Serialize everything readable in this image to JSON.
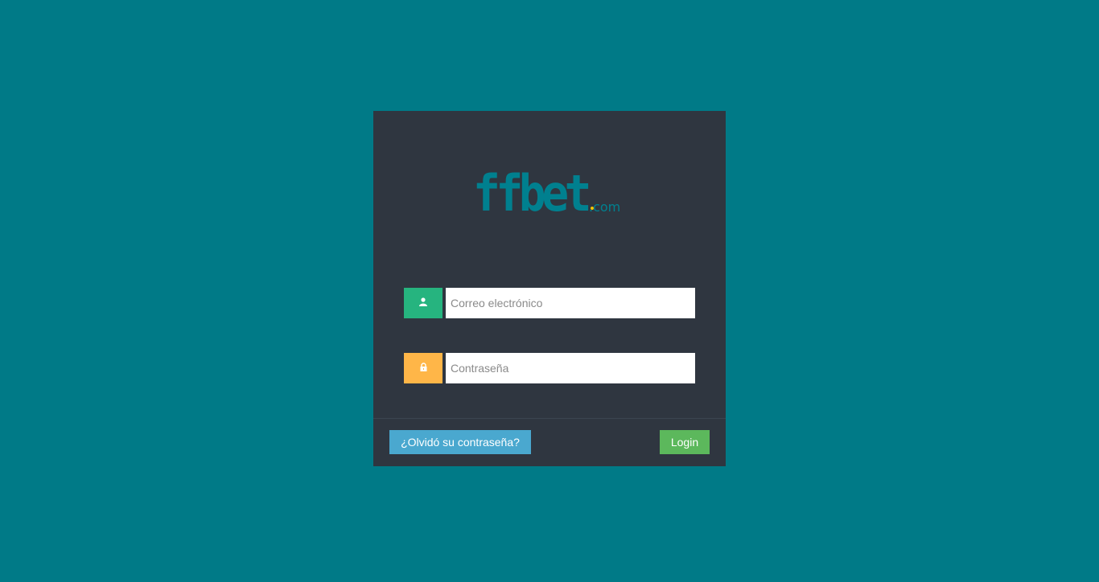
{
  "logo": {
    "main_text": "ffbet",
    "suffix_text": ".com"
  },
  "login_form": {
    "email": {
      "placeholder": "Correo electrónico",
      "value": "",
      "icon": "user-icon"
    },
    "password": {
      "placeholder": "Contraseña",
      "value": "",
      "icon": "lock-icon"
    },
    "forgot_label": "¿Olvidó su contraseña?",
    "login_label": "Login"
  },
  "colors": {
    "background": "#007a87",
    "card": "#2f3640",
    "email_addon": "#26b47f",
    "password_addon": "#ffb648",
    "forgot_button": "#4aa8cf",
    "login_button": "#5cb85c",
    "logo": "#00808f"
  }
}
